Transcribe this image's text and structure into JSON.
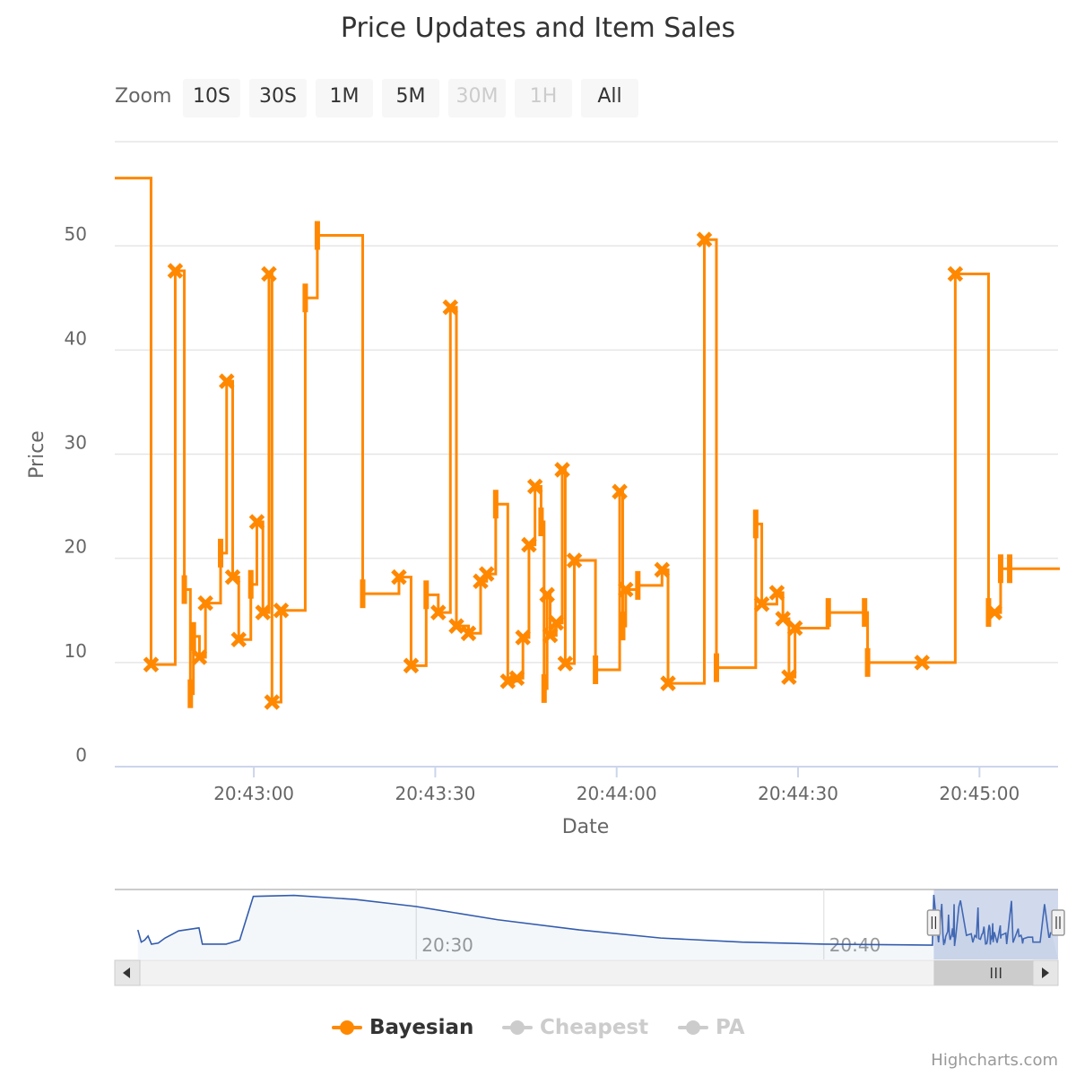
{
  "title": "Price Updates and Item Sales",
  "zoom": {
    "label": "Zoom",
    "buttons": [
      {
        "label": "10S",
        "enabled": true
      },
      {
        "label": "30S",
        "enabled": true
      },
      {
        "label": "1M",
        "enabled": true
      },
      {
        "label": "5M",
        "enabled": true
      },
      {
        "label": "30M",
        "enabled": false
      },
      {
        "label": "1H",
        "enabled": false
      },
      {
        "label": "All",
        "enabled": true
      }
    ]
  },
  "legend": [
    {
      "name": "Bayesian",
      "color": "#ff8800",
      "visible": true
    },
    {
      "name": "Cheapest",
      "color": "#cccccc",
      "visible": false
    },
    {
      "name": "PA",
      "color": "#cccccc",
      "visible": false
    }
  ],
  "credits": "Highcharts.com",
  "navigator": {
    "tick_labels": [
      {
        "t": "20:30:00",
        "label": "20:30"
      },
      {
        "t": "20:40:00",
        "label": "20:40"
      }
    ],
    "range": [
      "20:22:36",
      "20:45:45"
    ],
    "selected": [
      "20:42:42",
      "20:45:45"
    ],
    "series": [
      {
        "t": "20:23:10",
        "v": 22
      },
      {
        "t": "20:23:15",
        "v": 10
      },
      {
        "t": "20:23:20",
        "v": 12
      },
      {
        "t": "20:23:25",
        "v": 16
      },
      {
        "t": "20:23:30",
        "v": 8
      },
      {
        "t": "20:23:40",
        "v": 9
      },
      {
        "t": "20:23:50",
        "v": 14
      },
      {
        "t": "20:24:10",
        "v": 21
      },
      {
        "t": "20:24:30",
        "v": 23
      },
      {
        "t": "20:24:40",
        "v": 24
      },
      {
        "t": "20:24:45",
        "v": 8
      },
      {
        "t": "20:25:20",
        "v": 8
      },
      {
        "t": "20:25:40",
        "v": 12
      },
      {
        "t": "20:26:00",
        "v": 55
      },
      {
        "t": "20:27:00",
        "v": 56
      },
      {
        "t": "20:28:30",
        "v": 52
      },
      {
        "t": "20:30:00",
        "v": 45
      },
      {
        "t": "20:32:00",
        "v": 32
      },
      {
        "t": "20:34:00",
        "v": 22
      },
      {
        "t": "20:36:00",
        "v": 14
      },
      {
        "t": "20:38:00",
        "v": 10
      },
      {
        "t": "20:40:00",
        "v": 8
      },
      {
        "t": "20:42:40",
        "v": 7
      }
    ]
  },
  "chart_data": {
    "type": "line",
    "step": true,
    "xlabel": "Date",
    "ylabel": "Price",
    "x_range": [
      "20:42:37",
      "20:45:13"
    ],
    "ylim": [
      0,
      60
    ],
    "yticks": [
      0,
      10,
      20,
      30,
      40,
      50
    ],
    "xticks": [
      "20:43:00",
      "20:43:30",
      "20:44:00",
      "20:44:30",
      "20:45:00"
    ],
    "grid": true,
    "series": [
      {
        "name": "Bayesian",
        "color": "#ff8800",
        "points": [
          {
            "t": "20:42:37.0",
            "v": 56.5,
            "m": "none"
          },
          {
            "t": "20:42:43.0",
            "v": 9.8,
            "m": "x"
          },
          {
            "t": "20:42:47.0",
            "v": 47.6,
            "m": "x"
          },
          {
            "t": "20:42:48.5",
            "v": 17.0,
            "m": "bar"
          },
          {
            "t": "20:42:49.5",
            "v": 7.0,
            "m": "bar"
          },
          {
            "t": "20:42:50.0",
            "v": 12.5,
            "m": "bar"
          },
          {
            "t": "20:42:51.0",
            "v": 10.5,
            "m": "x"
          },
          {
            "t": "20:42:52.0",
            "v": 15.7,
            "m": "x"
          },
          {
            "t": "20:42:54.5",
            "v": 20.5,
            "m": "bar"
          },
          {
            "t": "20:42:55.5",
            "v": 37.0,
            "m": "x"
          },
          {
            "t": "20:42:56.5",
            "v": 18.2,
            "m": "x"
          },
          {
            "t": "20:42:57.5",
            "v": 12.2,
            "m": "x"
          },
          {
            "t": "20:42:59.5",
            "v": 17.5,
            "m": "bar"
          },
          {
            "t": "20:43:00.5",
            "v": 23.5,
            "m": "x"
          },
          {
            "t": "20:43:01.5",
            "v": 14.8,
            "m": "x"
          },
          {
            "t": "20:43:02.5",
            "v": 47.3,
            "m": "x"
          },
          {
            "t": "20:43:03.0",
            "v": 6.2,
            "m": "x"
          },
          {
            "t": "20:43:04.5",
            "v": 15.0,
            "m": "x"
          },
          {
            "t": "20:43:08.5",
            "v": 45.0,
            "m": "bar"
          },
          {
            "t": "20:43:10.5",
            "v": 51.0,
            "m": "bar"
          },
          {
            "t": "20:43:18.0",
            "v": 16.6,
            "m": "bar"
          },
          {
            "t": "20:43:24.0",
            "v": 18.2,
            "m": "x"
          },
          {
            "t": "20:43:26.0",
            "v": 9.7,
            "m": "x"
          },
          {
            "t": "20:43:28.5",
            "v": 16.5,
            "m": "bar"
          },
          {
            "t": "20:43:30.5",
            "v": 14.8,
            "m": "x"
          },
          {
            "t": "20:43:32.5",
            "v": 44.1,
            "m": "x"
          },
          {
            "t": "20:43:33.5",
            "v": 13.5,
            "m": "x"
          },
          {
            "t": "20:43:35.5",
            "v": 12.8,
            "m": "x"
          },
          {
            "t": "20:43:37.5",
            "v": 17.8,
            "m": "x"
          },
          {
            "t": "20:43:38.5",
            "v": 18.5,
            "m": "x"
          },
          {
            "t": "20:43:40.0",
            "v": 25.2,
            "m": "bar"
          },
          {
            "t": "20:43:42.0",
            "v": 8.2,
            "m": "x"
          },
          {
            "t": "20:43:43.5",
            "v": 8.5,
            "m": "x"
          },
          {
            "t": "20:43:44.5",
            "v": 12.4,
            "m": "x"
          },
          {
            "t": "20:43:45.5",
            "v": 21.3,
            "m": "x"
          },
          {
            "t": "20:43:46.5",
            "v": 26.9,
            "m": "x"
          },
          {
            "t": "20:43:47.5",
            "v": 23.5,
            "m": "bar"
          },
          {
            "t": "20:43:48.0",
            "v": 7.5,
            "m": "bar"
          },
          {
            "t": "20:43:48.5",
            "v": 16.5,
            "m": "x"
          },
          {
            "t": "20:43:49.0",
            "v": 12.6,
            "m": "x"
          },
          {
            "t": "20:43:50.0",
            "v": 13.8,
            "m": "x"
          },
          {
            "t": "20:43:51.0",
            "v": 28.5,
            "m": "x"
          },
          {
            "t": "20:43:51.5",
            "v": 9.9,
            "m": "x"
          },
          {
            "t": "20:43:53.0",
            "v": 19.8,
            "m": "x"
          },
          {
            "t": "20:43:56.5",
            "v": 9.3,
            "m": "bar"
          },
          {
            "t": "20:44:00.5",
            "v": 26.4,
            "m": "x"
          },
          {
            "t": "20:44:01.0",
            "v": 13.5,
            "m": "bar"
          },
          {
            "t": "20:44:01.5",
            "v": 17.0,
            "m": "x"
          },
          {
            "t": "20:44:03.5",
            "v": 17.4,
            "m": "bar"
          },
          {
            "t": "20:44:07.5",
            "v": 18.9,
            "m": "x"
          },
          {
            "t": "20:44:08.5",
            "v": 8.0,
            "m": "x"
          },
          {
            "t": "20:44:14.5",
            "v": 50.6,
            "m": "x"
          },
          {
            "t": "20:44:16.5",
            "v": 9.5,
            "m": "bar"
          },
          {
            "t": "20:44:23.0",
            "v": 23.3,
            "m": "bar"
          },
          {
            "t": "20:44:24.0",
            "v": 15.6,
            "m": "x"
          },
          {
            "t": "20:44:26.5",
            "v": 16.7,
            "m": "x"
          },
          {
            "t": "20:44:27.5",
            "v": 14.2,
            "m": "x"
          },
          {
            "t": "20:44:28.5",
            "v": 8.6,
            "m": "x"
          },
          {
            "t": "20:44:29.5",
            "v": 13.3,
            "m": "x"
          },
          {
            "t": "20:44:35.0",
            "v": 14.8,
            "m": "bar"
          },
          {
            "t": "20:44:41.0",
            "v": 14.8,
            "m": "bar"
          },
          {
            "t": "20:44:41.5",
            "v": 10.0,
            "m": "bar"
          },
          {
            "t": "20:44:50.5",
            "v": 10.0,
            "m": "x"
          },
          {
            "t": "20:44:56.0",
            "v": 47.3,
            "m": "x"
          },
          {
            "t": "20:45:01.5",
            "v": 14.8,
            "m": "bar"
          },
          {
            "t": "20:45:02.5",
            "v": 14.8,
            "m": "x"
          },
          {
            "t": "20:45:03.5",
            "v": 19.0,
            "m": "bar"
          },
          {
            "t": "20:45:05.0",
            "v": 19.0,
            "m": "bar"
          }
        ]
      }
    ]
  }
}
